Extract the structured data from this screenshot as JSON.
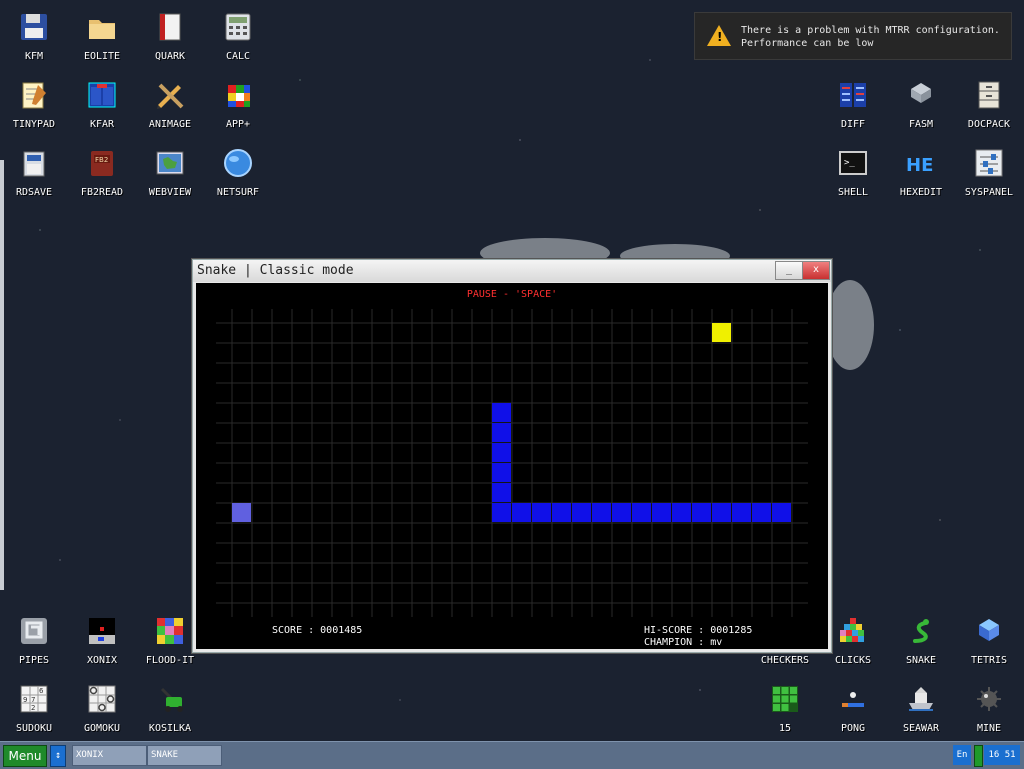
{
  "desktop": {
    "icons": [
      {
        "id": "kfm",
        "label": "KFM",
        "icon": "floppy-icon"
      },
      {
        "id": "eolite",
        "label": "EOLITE",
        "icon": "folder-icon"
      },
      {
        "id": "quark",
        "label": "QUARK",
        "icon": "notebook-icon"
      },
      {
        "id": "calc",
        "label": "CALC",
        "icon": "calculator-icon"
      },
      {
        "id": "tinypad",
        "label": "TINYPAD",
        "icon": "notepad-icon"
      },
      {
        "id": "kfar",
        "label": "KFAR",
        "icon": "panels-icon"
      },
      {
        "id": "animage",
        "label": "ANIMAGE",
        "icon": "pencil-icon"
      },
      {
        "id": "appplus",
        "label": "APP+",
        "icon": "cube-icon"
      },
      {
        "id": "rdsave",
        "label": "RDSAVE",
        "icon": "save-disk-icon"
      },
      {
        "id": "fb2read",
        "label": "FB2READ",
        "icon": "book-icon"
      },
      {
        "id": "webview",
        "label": "WEBVIEW",
        "icon": "globe-map-icon"
      },
      {
        "id": "netsurf",
        "label": "NETSURF",
        "icon": "globe-icon"
      },
      {
        "id": "diff",
        "label": "DIFF",
        "icon": "diff-icon"
      },
      {
        "id": "fasm",
        "label": "FASM",
        "icon": "chip-icon"
      },
      {
        "id": "docpack",
        "label": "DOCPACK",
        "icon": "cabinet-icon"
      },
      {
        "id": "shell",
        "label": "SHELL",
        "icon": "terminal-icon"
      },
      {
        "id": "hexedit",
        "label": "HEXEDIT",
        "icon": "hex-icon"
      },
      {
        "id": "syspanel",
        "label": "SYSPANEL",
        "icon": "sliders-icon"
      },
      {
        "id": "pipes",
        "label": "PIPES",
        "icon": "pipes-icon"
      },
      {
        "id": "xonix",
        "label": "XONIX",
        "icon": "xonix-icon"
      },
      {
        "id": "floodit",
        "label": "FLOOD-IT",
        "icon": "flood-icon"
      },
      {
        "id": "sudoku",
        "label": "SUDOKU",
        "icon": "sudoku-icon"
      },
      {
        "id": "gomoku",
        "label": "GOMOKU",
        "icon": "gomoku-icon"
      },
      {
        "id": "kosilka",
        "label": "KOSILKA",
        "icon": "mower-icon"
      },
      {
        "id": "checkers",
        "label": "CHECKERS",
        "icon": "checkers-icon"
      },
      {
        "id": "clicks",
        "label": "CLICKS",
        "icon": "blocks-icon"
      },
      {
        "id": "snake",
        "label": "SNAKE",
        "icon": "snake-icon"
      },
      {
        "id": "tetris",
        "label": "TETRIS",
        "icon": "tetris-icon"
      },
      {
        "id": "fifteen",
        "label": "15",
        "icon": "fifteen-icon"
      },
      {
        "id": "pong",
        "label": "PONG",
        "icon": "pong-icon"
      },
      {
        "id": "seawar",
        "label": "SEAWAR",
        "icon": "ship-icon"
      },
      {
        "id": "mine",
        "label": "MINE",
        "icon": "mine-icon"
      }
    ]
  },
  "notification": {
    "line1": "There is a problem with MTRR configuration.",
    "line2": "Performance can be low",
    "icon": "warning-icon",
    "symbol": "!"
  },
  "window": {
    "title": "Snake | Classic mode",
    "min_label": "_",
    "close_label": "x",
    "pause_text": "PAUSE - 'SPACE'",
    "score_text": "SCORE : 0001485",
    "hiscore_text": "HI-SCORE : 0001285",
    "champion_text": "CHAMPION : mv",
    "colors": {
      "snake": "#1010e8",
      "snake_tail": "#6060e0",
      "food": "#f0f000",
      "grid": "#2a2a2a"
    },
    "board": {
      "cols": 28,
      "rows": 14,
      "food": [
        24,
        0
      ],
      "snake": [
        [
          13,
          4
        ],
        [
          13,
          5
        ],
        [
          13,
          6
        ],
        [
          13,
          7
        ],
        [
          13,
          8
        ],
        [
          13,
          9
        ],
        [
          14,
          9
        ],
        [
          15,
          9
        ],
        [
          16,
          9
        ],
        [
          17,
          9
        ],
        [
          18,
          9
        ],
        [
          19,
          9
        ],
        [
          20,
          9
        ],
        [
          21,
          9
        ],
        [
          22,
          9
        ],
        [
          23,
          9
        ],
        [
          24,
          9
        ],
        [
          25,
          9
        ],
        [
          26,
          9
        ],
        [
          27,
          9
        ]
      ],
      "tail_marker": [
        0,
        9
      ]
    }
  },
  "taskbar": {
    "menu_label": "Menu",
    "arrow_label": "↕",
    "tasks": [
      "XONIX",
      "SNAKE"
    ],
    "lang": "En",
    "clock": "16 51"
  }
}
